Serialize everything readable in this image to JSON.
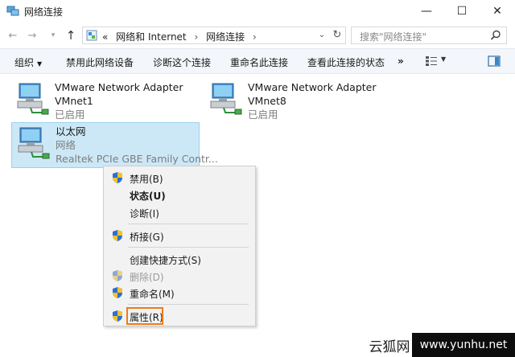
{
  "window": {
    "title": "网络连接",
    "minimize": "—",
    "maximize": "☐",
    "close": "✕"
  },
  "nav": {
    "back": "←",
    "forward": "→",
    "history": "▾",
    "up": "↑",
    "refresh": "↻",
    "address_dropdown": "⌄"
  },
  "address": {
    "overflow": "«",
    "crumbs": [
      "网络和 Internet",
      "网络连接"
    ],
    "separator": "›"
  },
  "search": {
    "placeholder": "搜索\"网络连接\""
  },
  "toolbar": {
    "organize": "组织",
    "disable_device": "禁用此网络设备",
    "diagnose": "诊断这个连接",
    "rename": "重命名此连接",
    "view_status": "查看此连接的状态",
    "more": "»",
    "caret": "▼"
  },
  "adapters": [
    {
      "name": "VMware Network Adapter",
      "line2": "VMnet1",
      "line3": "已启用"
    },
    {
      "name": "VMware Network Adapter",
      "line2": "VMnet8",
      "line3": "已启用"
    },
    {
      "name": "以太网",
      "line2": "网络",
      "line3": "Realtek PCIe GBE Family Contr..."
    }
  ],
  "context_menu": {
    "disable": "禁用(B)",
    "status": "状态(U)",
    "diagnose": "诊断(I)",
    "bridge": "桥接(G)",
    "create_shortcut": "创建快捷方式(S)",
    "delete": "删除(D)",
    "rename": "重命名(M)",
    "properties": "属性(R)"
  },
  "watermark": {
    "left": "云狐网",
    "right": "www.yunhu.net"
  },
  "colors": {
    "selection_bg": "#cce8f7",
    "selection_border": "#99d1f0",
    "highlight_box": "#ef7a1a",
    "toolbar_bg": "#f3f6fb"
  }
}
